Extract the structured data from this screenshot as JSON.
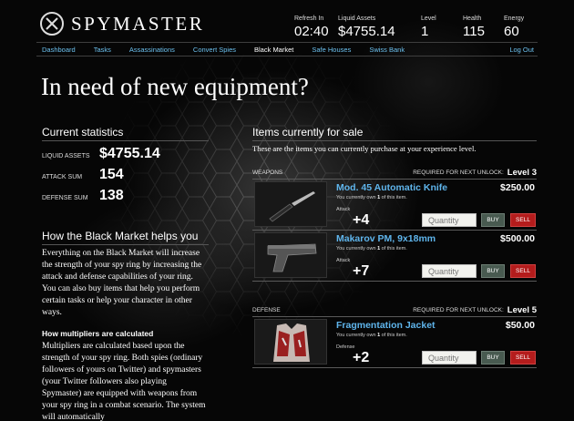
{
  "app": {
    "name": "SPYMASTER"
  },
  "stats": [
    {
      "label": "Refresh In",
      "value": "02:40"
    },
    {
      "label": "Liquid Assets",
      "value": "$4755.14"
    },
    {
      "label": "Level",
      "value": "1"
    },
    {
      "label": "Health",
      "value": "115"
    },
    {
      "label": "Energy",
      "value": "60"
    }
  ],
  "nav": [
    {
      "label": "Dashboard"
    },
    {
      "label": "Tasks"
    },
    {
      "label": "Assassinations"
    },
    {
      "label": "Convert Spies"
    },
    {
      "label": "Black Market"
    },
    {
      "label": "Safe Houses"
    },
    {
      "label": "Swiss Bank"
    }
  ],
  "nav_logout": "Log Out",
  "page_title": "In need of new equipment?",
  "current_stats": {
    "title": "Current statistics",
    "rows": [
      {
        "label": "LIQUID ASSETS",
        "value": "$4755.14"
      },
      {
        "label": "ATTACK SUM",
        "value": "154"
      },
      {
        "label": "DEFENSE SUM",
        "value": "138"
      }
    ]
  },
  "help": {
    "title": "How the Black Market helps you",
    "para": "Everything on the Black Market will increase the strength of your spy ring by increasing the attack and defense capabilities of your ring. You can also buy items that help you perform certain tasks or help your character in other ways.",
    "mult_title": "How multipliers are calculated",
    "mult_para": "Multipliers are calculated based upon the strength of your spy ring. Both spies (ordinary followers of yours on Twitter) and spymasters (your Twitter followers also playing Spymaster) are equipped with weapons from your spy ring in a combat scenario. The system will automatically"
  },
  "items_section": {
    "title": "Items currently for sale",
    "subtitle": "These are the items you can currently purchase at your experience level.",
    "req_label": "REQUIRED FOR NEXT UNLOCK:",
    "qty_placeholder": "Quantity",
    "buy_label": "BUY",
    "sell_label": "SELL",
    "categories": [
      {
        "name": "WEAPONS",
        "level": "Level 3",
        "items": [
          {
            "name": "Mod. 45 Automatic Knife",
            "price": "$250.00",
            "own_prefix": "You currently own",
            "own_count": "1",
            "own_suffix": "of this item.",
            "bonus_label": "Attack",
            "bonus": "+4",
            "icon": "knife-icon"
          },
          {
            "name": "Makarov PM, 9x18mm",
            "price": "$500.00",
            "own_prefix": "You currently own",
            "own_count": "1",
            "own_suffix": "of this item.",
            "bonus_label": "Attack",
            "bonus": "+7",
            "icon": "pistol-icon"
          }
        ]
      },
      {
        "name": "DEFENSE",
        "level": "Level 5",
        "items": [
          {
            "name": "Fragmentation Jacket",
            "price": "$50.00",
            "own_prefix": "You currently own",
            "own_count": "1",
            "own_suffix": "of this item.",
            "bonus_label": "Defense",
            "bonus": "+2",
            "icon": "jacket-icon"
          }
        ]
      }
    ]
  },
  "colors": {
    "link": "#6cc0ee",
    "item_name": "#5fb5ec",
    "sell": "#b41c1c",
    "buy": "#485a50"
  }
}
